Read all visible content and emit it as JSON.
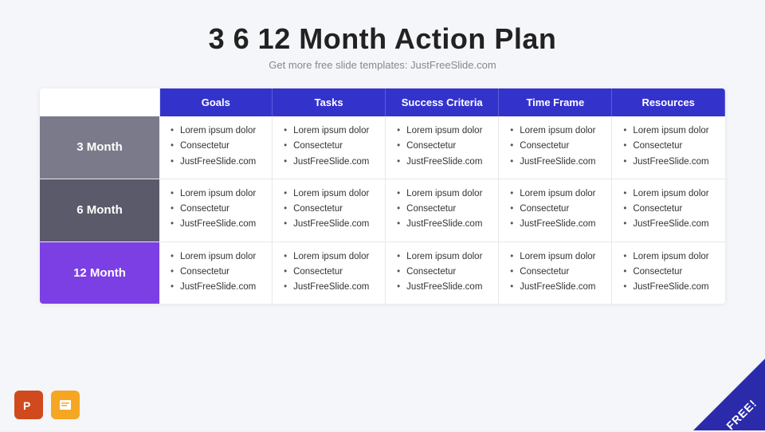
{
  "title": "3 6 12 Month Action Plan",
  "subtitle": "Get more free slide templates: JustFreeSlide.com",
  "table": {
    "headers": [
      "",
      "Goals",
      "Tasks",
      "Success Criteria",
      "Time Frame",
      "Resources"
    ],
    "rows": [
      {
        "label": "3 Month",
        "rowClass": "row-3month",
        "cells": [
          [
            "Lorem ipsum dolor",
            "Consectetur",
            "JustFreeSlide.com"
          ],
          [
            "Lorem ipsum dolor",
            "Consectetur",
            "JustFreeSlide.com"
          ],
          [
            "Lorem ipsum dolor",
            "Consectetur",
            "JustFreeSlide.com"
          ],
          [
            "Lorem ipsum dolor",
            "Consectetur",
            "JustFreeSlide.com"
          ],
          [
            "Lorem ipsum dolor",
            "Consectetur",
            "JustFreeSlide.com"
          ]
        ]
      },
      {
        "label": "6 Month",
        "rowClass": "row-6month",
        "cells": [
          [
            "Lorem ipsum dolor",
            "Consectetur",
            "JustFreeSlide.com"
          ],
          [
            "Lorem ipsum dolor",
            "Consectetur",
            "JustFreeSlide.com"
          ],
          [
            "Lorem ipsum dolor",
            "Consectetur",
            "JustFreeSlide.com"
          ],
          [
            "Lorem ipsum dolor",
            "Consectetur",
            "JustFreeSlide.com"
          ],
          [
            "Lorem ipsum dolor",
            "Consectetur",
            "JustFreeSlide.com"
          ]
        ]
      },
      {
        "label": "12 Month",
        "rowClass": "row-12month",
        "cells": [
          [
            "Lorem ipsum dolor",
            "Consectetur",
            "JustFreeSlide.com"
          ],
          [
            "Lorem ipsum dolor",
            "Consectetur",
            "JustFreeSlide.com"
          ],
          [
            "Lorem ipsum dolor",
            "Consectetur",
            "JustFreeSlide.com"
          ],
          [
            "Lorem ipsum dolor",
            "Consectetur",
            "JustFreeSlide.com"
          ],
          [
            "Lorem ipsum dolor",
            "Consectetur",
            "JustFreeSlide.com"
          ]
        ]
      }
    ]
  },
  "free_badge": "FREE!",
  "icons": {
    "ppt": "🅿",
    "gslides": "🟨"
  }
}
